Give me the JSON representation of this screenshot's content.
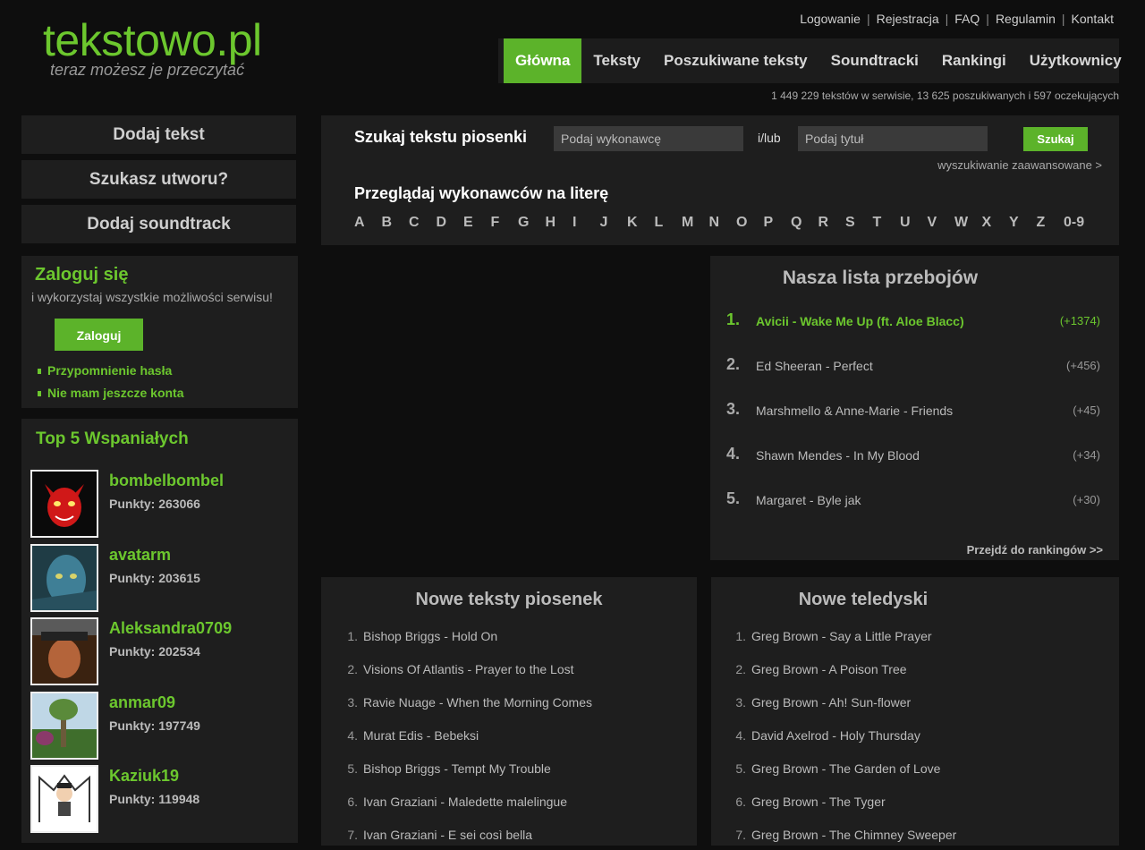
{
  "header": {
    "logo": "tekstowo.pl",
    "tagline": "teraz możesz je przeczytać",
    "toplinks": [
      "Logowanie",
      "Rejestracja",
      "FAQ",
      "Regulamin",
      "Kontakt"
    ],
    "nav": [
      "Główna",
      "Teksty",
      "Poszukiwane teksty",
      "Soundtracki",
      "Rankingi",
      "Użytkownicy"
    ],
    "active_nav": "Główna",
    "stats": "1 449 229 tekstów w serwisie, 13 625 poszukiwanych i 597 oczekujących"
  },
  "sidebar": {
    "buttons": [
      "Dodaj tekst",
      "Szukasz utworu?",
      "Dodaj soundtrack"
    ],
    "login": {
      "title": "Zaloguj się",
      "subtitle": "i wykorzystaj wszystkie możliwości serwisu!",
      "button": "Zaloguj",
      "links": [
        "Przypomnienie hasła",
        "Nie mam jeszcze konta"
      ]
    },
    "top5": {
      "title": "Top 5  Wspaniałych",
      "points_label": "Punkty:",
      "users": [
        {
          "name": "bombelbombel",
          "points": "263066"
        },
        {
          "name": "avatarm",
          "points": "203615"
        },
        {
          "name": "Aleksandra0709",
          "points": "202534"
        },
        {
          "name": "anmar09",
          "points": "197749"
        },
        {
          "name": "Kaziuk19",
          "points": "119948"
        }
      ]
    }
  },
  "search": {
    "label": "Szukaj tekstu piosenki",
    "artist_placeholder": "Podaj wykonawcę",
    "andor": "i/lub",
    "title_placeholder": "Podaj tytuł",
    "button": "Szukaj",
    "advanced": "wyszukiwanie zaawansowane >",
    "browse_label": "Przeglądaj wykonawców na literę",
    "letters": [
      "A",
      "B",
      "C",
      "D",
      "E",
      "F",
      "G",
      "H",
      "I",
      "J",
      "K",
      "L",
      "M",
      "N",
      "O",
      "P",
      "Q",
      "R",
      "S",
      "T",
      "U",
      "V",
      "W",
      "X",
      "Y",
      "Z",
      "0-9"
    ]
  },
  "chart": {
    "title": "Nasza lista przebojów",
    "items": [
      {
        "rank": "1.",
        "song": "Avicii - Wake Me Up (ft. Aloe Blacc)",
        "delta": "(+1374)"
      },
      {
        "rank": "2.",
        "song": "Ed Sheeran - Perfect",
        "delta": "(+456)"
      },
      {
        "rank": "3.",
        "song": "Marshmello & Anne-Marie - Friends",
        "delta": "(+45)"
      },
      {
        "rank": "4.",
        "song": "Shawn Mendes - In My Blood",
        "delta": "(+34)"
      },
      {
        "rank": "5.",
        "song": "Margaret - Byle jak",
        "delta": "(+30)"
      }
    ],
    "more": "Przejdź do rankingów >>"
  },
  "new_lyrics": {
    "title": "Nowe teksty piosenek",
    "items": [
      "Bishop Briggs - Hold On",
      "Visions Of Atlantis - Prayer to the Lost",
      "Ravie Nuage - When the Morning Comes",
      "Murat Edis - Bebeksi",
      "Bishop Briggs - Tempt My Trouble",
      "Ivan Graziani - Maledette malelingue",
      "Ivan Graziani - E sei così bella"
    ]
  },
  "new_videos": {
    "title": "Nowe teledyski",
    "items": [
      "Greg Brown - Say a Little Prayer",
      "Greg Brown - A Poison Tree",
      "Greg Brown - Ah! Sun-flower",
      "David Axelrod - Holy Thursday",
      "Greg Brown - The Garden of Love",
      "Greg Brown - The Tyger",
      "Greg Brown - The Chimney Sweeper"
    ]
  },
  "colors": {
    "accent": "#5cb32a",
    "accent_text": "#6cc72e",
    "background": "#0e0e0e",
    "panel": "#1e1e1e"
  }
}
